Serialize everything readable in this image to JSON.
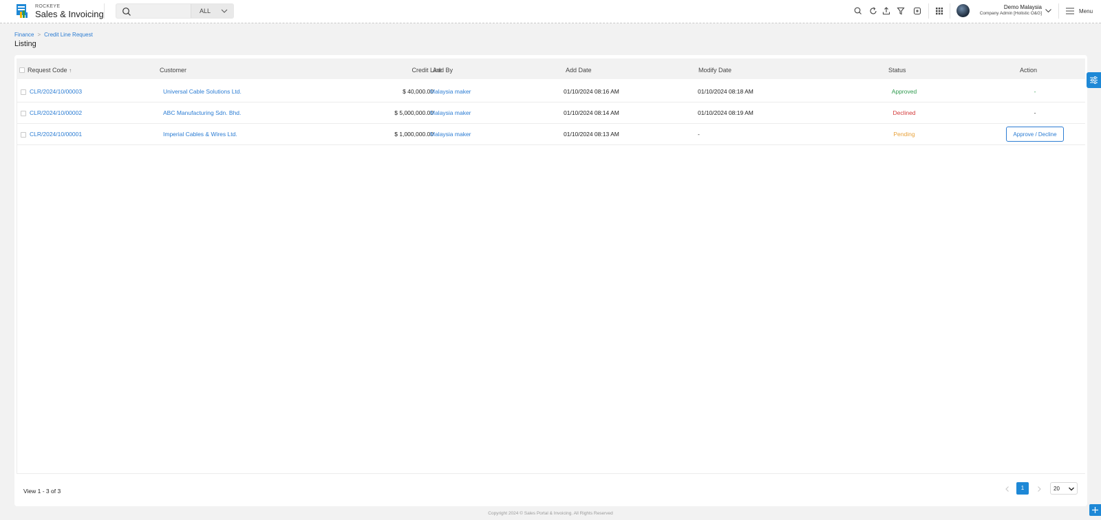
{
  "app": {
    "brand_sub": "ROCKEYE",
    "brand_main": "Sales & Invoicing"
  },
  "search": {
    "placeholder": "",
    "scope": "ALL"
  },
  "toolbar_icons": [
    "search-icon",
    "refresh-icon",
    "upload-icon",
    "filter-icon",
    "export-icon",
    "apps-grid-icon"
  ],
  "user": {
    "name": "Demo Malaysia",
    "role": "Company Admin [Holistic O&G]"
  },
  "menu": {
    "label": "Menu"
  },
  "breadcrumb": [
    "Finance",
    "Credit Line Request"
  ],
  "page": {
    "title": "Listing"
  },
  "table": {
    "columns": {
      "request_code": "Request Code",
      "customer": "Customer",
      "credit_line": "Credit Line",
      "add_by": "Add By",
      "add_date": "Add Date",
      "modify_date": "Modify Date",
      "status": "Status",
      "action": "Action"
    },
    "sort_indicator": "↑",
    "rows": [
      {
        "request_code": "CLR/2024/10/00003",
        "customer": "Universal Cable Solutions Ltd.",
        "credit_line": "$ 40,000.00",
        "add_by": "Malaysia maker",
        "add_date": "01/10/2024 08:16 AM",
        "modify_date": "01/10/2024 08:18 AM",
        "status": "Approved",
        "action": "-"
      },
      {
        "request_code": "CLR/2024/10/00002",
        "customer": "ABC Manufacturing Sdn. Bhd.",
        "credit_line": "$ 5,000,000.00",
        "add_by": "Malaysia maker",
        "add_date": "01/10/2024 08:14 AM",
        "modify_date": "01/10/2024 08:19 AM",
        "status": "Declined",
        "action": "-"
      },
      {
        "request_code": "CLR/2024/10/00001",
        "customer": "Imperial Cables & Wires Ltd.",
        "credit_line": "$ 1,000,000.00",
        "add_by": "Malaysia maker",
        "add_date": "01/10/2024 08:13 AM",
        "modify_date": "-",
        "status": "Pending",
        "action": "Approve / Decline"
      }
    ]
  },
  "pagination": {
    "summary": "View 1 - 3 of 3",
    "current_page": "1",
    "page_size": "20"
  },
  "footer": {
    "copyright": "Copyright 2024 © Sales Portal & Invoicing. All Rights Reserved"
  },
  "colors": {
    "accent": "#1e88d6",
    "link": "#2b7cd3",
    "approved": "#2e9a4e",
    "declined": "#d43a3a",
    "pending": "#e8a23b"
  }
}
